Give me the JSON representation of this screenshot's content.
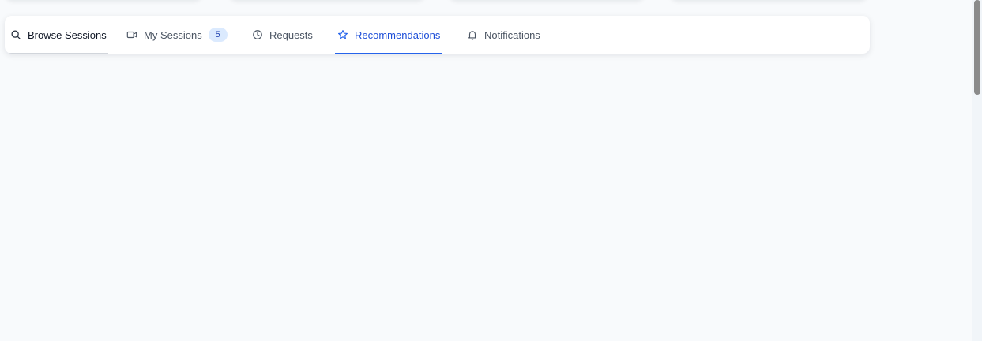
{
  "tabs": [
    {
      "label": "Browse Sessions",
      "icon": "search-icon",
      "state": "selected"
    },
    {
      "label": "My Sessions",
      "icon": "video-icon",
      "badge": "5"
    },
    {
      "label": "Requests",
      "icon": "clock-icon"
    },
    {
      "label": "Recommendations",
      "icon": "star-icon",
      "state": "active"
    },
    {
      "label": "Notifications",
      "icon": "bell-icon"
    }
  ],
  "colors": {
    "background": "#f8fafc",
    "accent": "#2563eb",
    "badge_bg": "#dbeafe"
  }
}
